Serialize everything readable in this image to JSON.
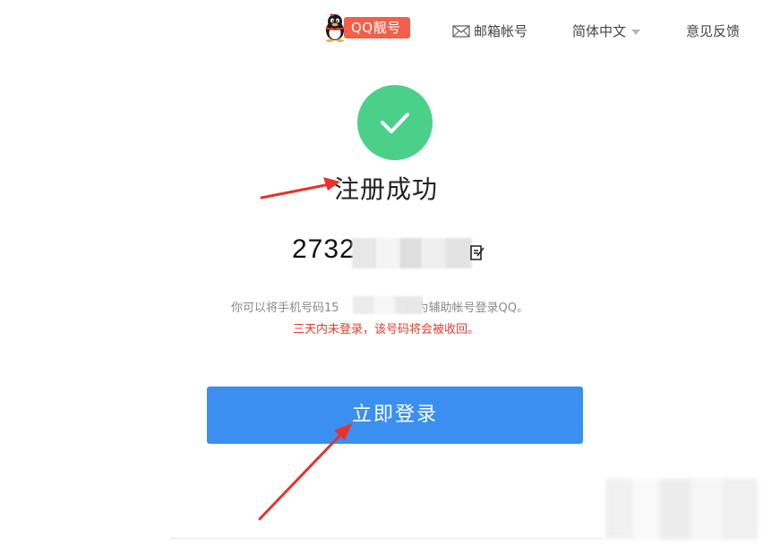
{
  "nav": {
    "qq_pretty_label": "QQ靓号",
    "mail_label": "邮箱帐号",
    "lang_label": "简体中文",
    "feedback_label": "意见反馈"
  },
  "success": {
    "title": "注册成功",
    "account_visible": "2732",
    "info_prefix": "你可以将手机号码15",
    "info_suffix": "作为辅助帐号登录QQ。",
    "warning": "三天内未登录，该号码将会被收回。"
  },
  "login_button": {
    "label": "立即登录"
  },
  "colors": {
    "success_green": "#4bd08a",
    "button_blue": "#3b8ff0",
    "warning_red": "#e63b2e",
    "badge_red": "#f25f4a",
    "arrow_red": "#e8322a"
  },
  "icons": {
    "penguin": "qq-penguin-icon",
    "mail": "mail-icon",
    "caret": "caret-down-icon",
    "check": "check-icon",
    "copy": "copy-icon"
  }
}
